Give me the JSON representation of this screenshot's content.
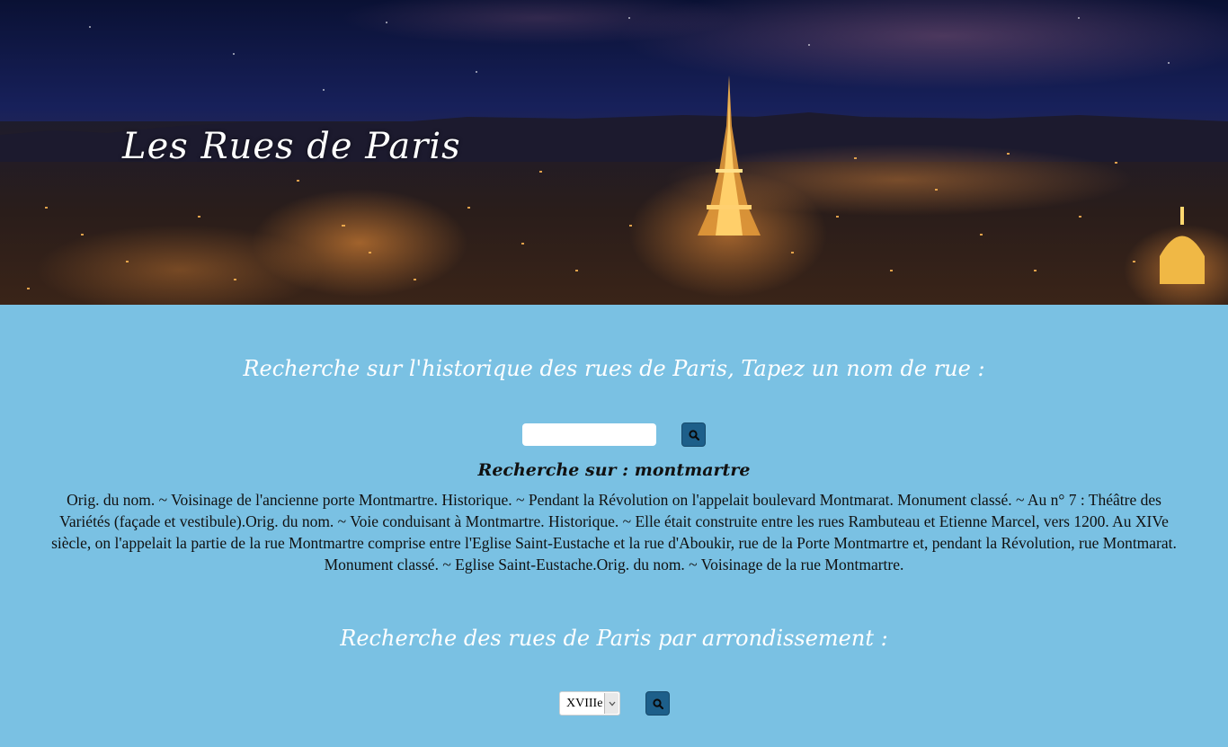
{
  "header": {
    "title": "Les Rues de Paris",
    "background_image": "paris-night-skyline"
  },
  "search_section": {
    "heading": "Recherche sur l'historique des rues de Paris, Tapez un nom de rue :",
    "input_value": "",
    "input_placeholder": "",
    "button_icon": "search-icon"
  },
  "result": {
    "title": "Recherche sur : montmartre",
    "text": "Orig. du nom. ~ Voisinage de l'ancienne porte Montmartre. Historique. ~ Pendant la Révolution on l'appelait boulevard Montmarat. Monument classé. ~ Au n° 7 : Théâtre des Variétés (façade et vestibule).Orig. du nom. ~ Voie conduisant à Montmartre. Historique. ~ Elle était construite entre les rues Rambuteau et Etienne Marcel, vers 1200. Au XIVe siècle, on l'appelait la partie de la rue Montmartre comprise entre l'Eglise Saint-Eustache et la rue d'Aboukir, rue de la Porte Montmartre et, pendant la Révolution, rue Montmarat. Monument classé. ~ Eglise Saint-Eustache.Orig. du nom. ~ Voisinage de la rue Montmartre."
  },
  "arrondissement_section": {
    "heading": "Recherche des rues de Paris par arrondissement :",
    "selected": "XVIIIe",
    "button_icon": "search-icon"
  },
  "colors": {
    "page_background": "#7ac1e3",
    "button_background": "#1d5f8a",
    "heading_text": "#ffffff",
    "body_text": "#111111"
  }
}
